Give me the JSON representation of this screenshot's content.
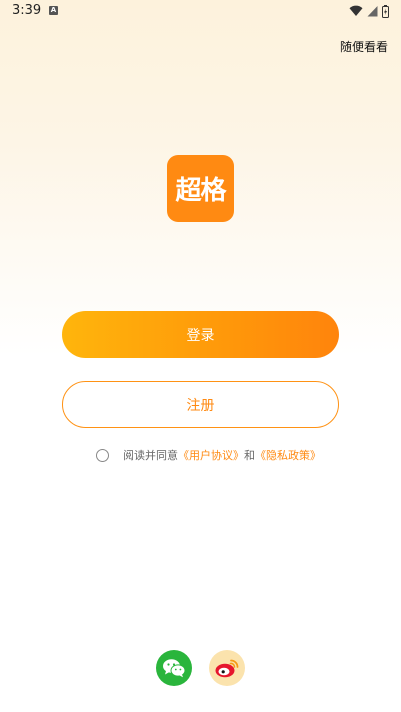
{
  "status_bar": {
    "time": "3:39",
    "notification_letter": "A"
  },
  "top_bar": {
    "skip_label": "随便看看"
  },
  "logo": {
    "text": "超格"
  },
  "actions": {
    "login_label": "登录",
    "register_label": "注册"
  },
  "agreement": {
    "prefix": "阅读并同意",
    "user_agreement": "《用户协议》",
    "conjunction": "和",
    "privacy_policy": "《隐私政策》"
  },
  "social_login": {
    "icons": [
      "wechat-icon",
      "weibo-icon"
    ]
  },
  "colors": {
    "accent": "#ff8a12",
    "wechat": "#2ab53c",
    "weibo_bg": "#fbe3ad"
  }
}
